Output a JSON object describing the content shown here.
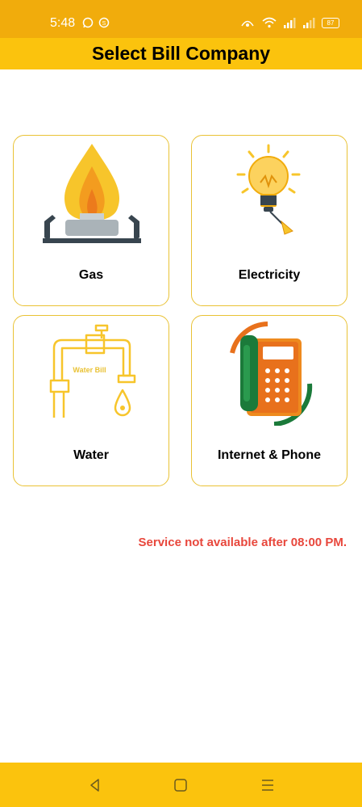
{
  "status_bar": {
    "time": "5:48",
    "battery": "87",
    "icons": [
      "whatsapp-icon",
      "chat-icon",
      "hotspot-icon",
      "wifi-icon",
      "signal-icon",
      "signal-icon",
      "battery-icon"
    ]
  },
  "header": {
    "title": "Select Bill Company"
  },
  "companies": [
    {
      "label": "Gas",
      "icon": "gas-stove-flame-icon"
    },
    {
      "label": "Electricity",
      "icon": "light-bulb-icon"
    },
    {
      "label": "Water",
      "icon": "water-tap-icon",
      "icon_text": "Water Bill"
    },
    {
      "label": "Internet & Phone",
      "icon": "telephone-icon"
    }
  ],
  "notice": "Service not available after 08:00 PM.",
  "nav": {
    "back": "back-icon",
    "home": "home-icon",
    "recents": "menu-icon"
  },
  "colors": {
    "status_bar": "#f1ac0c",
    "title_bar": "#fbc30d",
    "tile_border": "#e9c235",
    "notice": "#e8473c"
  }
}
